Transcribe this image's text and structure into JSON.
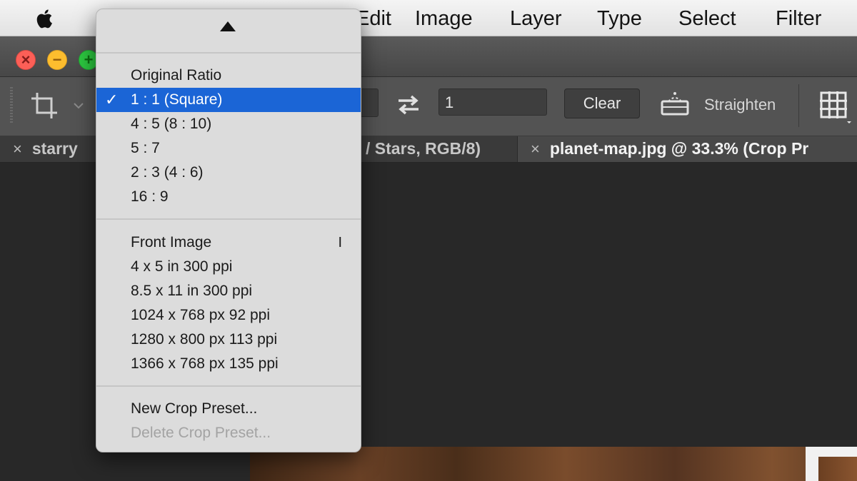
{
  "menubar": {
    "items": [
      "Edit",
      "Image",
      "Layer",
      "Type",
      "Select",
      "Filter"
    ]
  },
  "options_bar": {
    "height_value": "1",
    "clear_label": "Clear",
    "straighten_label": "Straighten"
  },
  "tabs": [
    {
      "label": "starry",
      "active": false
    },
    {
      "label": "/ Stars, RGB/8)",
      "active": false
    },
    {
      "label": "planet-map.jpg @ 33.3% (Crop Pr",
      "active": true
    }
  ],
  "dropdown": {
    "groups": [
      [
        {
          "label": "Original Ratio"
        },
        {
          "label": "1 : 1 (Square)",
          "checked": true,
          "selected": true
        },
        {
          "label": "4 : 5 (8 : 10)"
        },
        {
          "label": "5 : 7"
        },
        {
          "label": "2 : 3 (4 : 6)"
        },
        {
          "label": "16 : 9"
        }
      ],
      [
        {
          "label": "Front Image",
          "shortcut": "I"
        },
        {
          "label": "4 x 5 in 300 ppi"
        },
        {
          "label": "8.5 x 11 in 300 ppi"
        },
        {
          "label": "1024 x 768 px 92 ppi"
        },
        {
          "label": "1280 x 800 px 113 ppi"
        },
        {
          "label": "1366 x 768 px 135 ppi"
        }
      ],
      [
        {
          "label": "New Crop Preset..."
        },
        {
          "label": "Delete Crop Preset...",
          "disabled": true
        }
      ]
    ]
  },
  "colors": {
    "selection": "#1b65d6",
    "menu_bg": "#dcdcdc",
    "panel": "#535353",
    "workspace": "#282828"
  },
  "icons": [
    "apple-icon",
    "crop-tool-icon",
    "swap-icon",
    "straighten-icon",
    "grid-icon",
    "check-icon",
    "scroll-up-icon",
    "close-icon"
  ]
}
